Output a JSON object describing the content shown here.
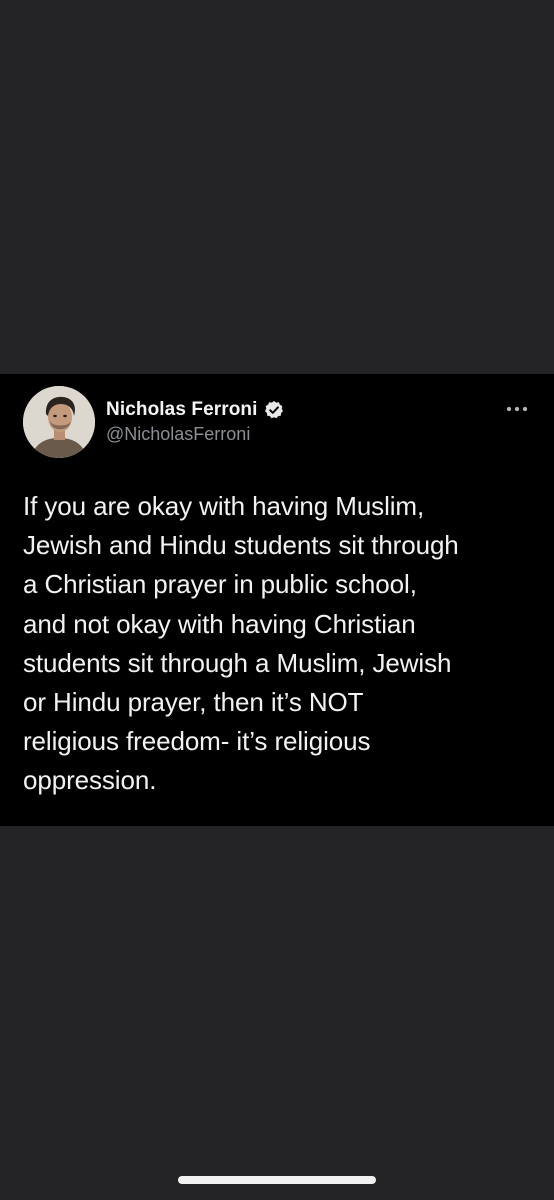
{
  "tweet": {
    "author": {
      "display_name": "Nicholas Ferroni",
      "handle": "@NicholasFerroni",
      "verified_icon": "verified-badge-icon",
      "avatar_icon": "avatar-photo"
    },
    "more_icon": "more-options-icon",
    "text": "If you are okay with having Muslim,\nJewish and Hindu students sit through\na Christian prayer in public school,\nand not okay with having Christian\nstudents sit through a Muslim, Jewish\nor Hindu prayer, then it’s NOT\nreligious freedom- it’s religious\noppression."
  },
  "colors": {
    "background": "#242426",
    "card": "#000000",
    "text": "#f2f2f2",
    "handle": "#8b8f94"
  }
}
